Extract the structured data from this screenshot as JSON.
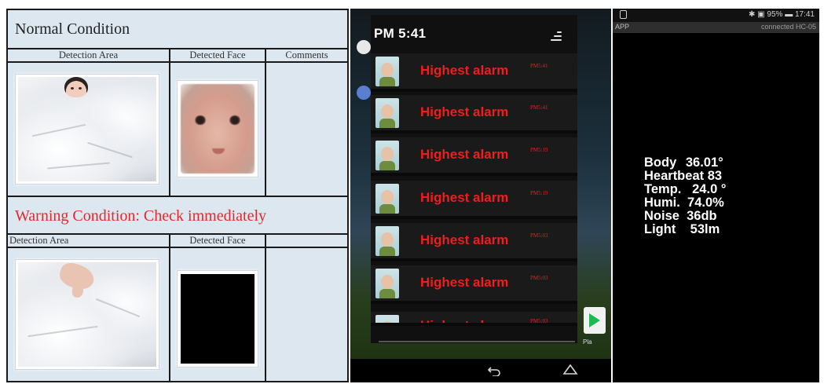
{
  "normal_section": {
    "title": "Normal Condition",
    "headers": [
      "Detection Area",
      "Detected Face",
      "Comments"
    ]
  },
  "warning_section": {
    "title": "Warning Condition: Check immediately",
    "title_color": "#e8262b",
    "headers": [
      "Detection Area",
      "Detected Face",
      ""
    ]
  },
  "phone_notifications": {
    "status_time": "PM 5:41",
    "clear_icon": "clear-all-icon",
    "items": [
      {
        "title": "Highest alarm",
        "time": "PM5:41"
      },
      {
        "title": "Highest alarm",
        "time": "PM5:41"
      },
      {
        "title": "Highest alarm",
        "time": "PM5:19"
      },
      {
        "title": "Highest alarm",
        "time": "PM5:19"
      },
      {
        "title": "Highest alarm",
        "time": "PM5:03"
      },
      {
        "title": "Highest alarm",
        "time": "PM5:03"
      },
      {
        "title": "Highest alarm",
        "time": "PM5:03"
      }
    ],
    "alarm_color": "#f11c1c",
    "play_label": "Pla"
  },
  "phone_sensor_app": {
    "status_right": "✱ ▣ 95% ▬ 17:41",
    "app_name": "APP",
    "connection": "connected HC-05",
    "readings": [
      {
        "label": "Body ",
        "value": "36.01°"
      },
      {
        "label": "Heartbeat",
        "value": " 83"
      },
      {
        "label": "Temp.",
        "value": "   24.0 °"
      },
      {
        "label": "Humi.",
        "value": "  74.0%"
      },
      {
        "label": "Noise",
        "value": "  36db"
      },
      {
        "label": "Light",
        "value": "    53lm"
      }
    ]
  }
}
